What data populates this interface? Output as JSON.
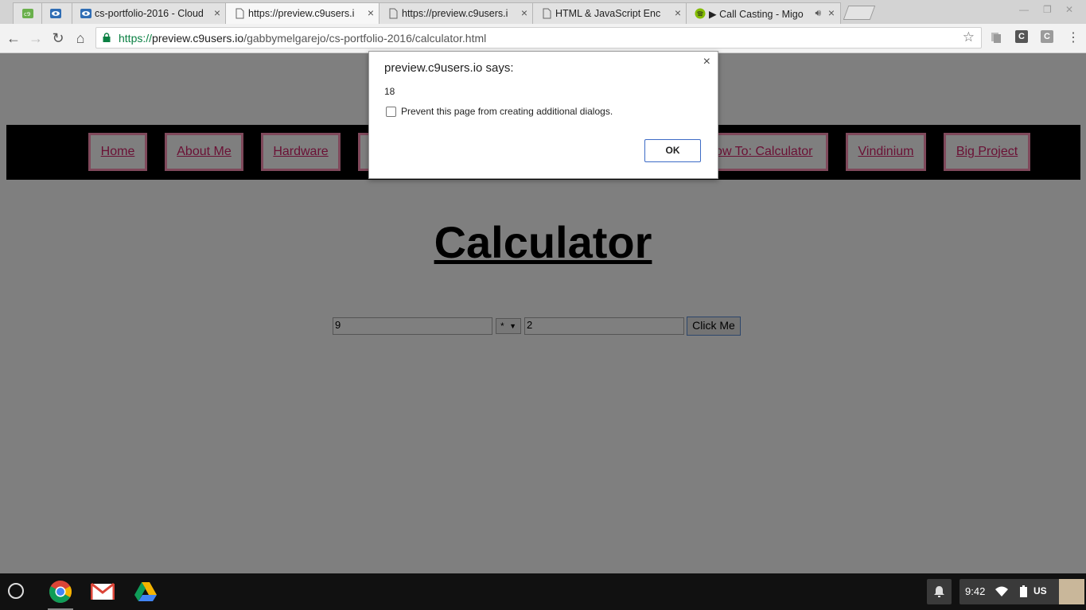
{
  "browser": {
    "tabs": [
      {
        "title": ""
      },
      {
        "title": ""
      },
      {
        "title": "cs-portfolio-2016 - Cloud"
      },
      {
        "title": "https://preview.c9users.i"
      },
      {
        "title": "https://preview.c9users.i"
      },
      {
        "title": "HTML & JavaScript Enc"
      },
      {
        "title": "▶ Call Casting - Migo"
      }
    ],
    "url": {
      "scheme": "https://",
      "host": "preview.c9users.io",
      "path": "/gabbymelgarejo/cs-portfolio-2016/calculator.html"
    },
    "extensions": [
      "C",
      "C"
    ]
  },
  "site": {
    "nav": [
      "Home",
      "About Me",
      "Hardware",
      "",
      "How To: Calculator",
      "Vindinium",
      "Big Project"
    ],
    "title": "Calculator",
    "calculator": {
      "first_value": "9",
      "operator": "*",
      "second_value": "2",
      "button_label": "Click Me"
    }
  },
  "dialog": {
    "title": "preview.c9users.io says:",
    "message": "18",
    "checkbox_label": "Prevent this page from creating additional dialogs.",
    "checkbox_checked": false,
    "ok_label": "OK"
  },
  "shelf": {
    "time": "9:42",
    "input_method": "US"
  },
  "colors": {
    "nav_link": "#d4236b",
    "nav_border": "#ff93b7",
    "nav_bar": "#000000",
    "url_secure": "#0b8043"
  }
}
